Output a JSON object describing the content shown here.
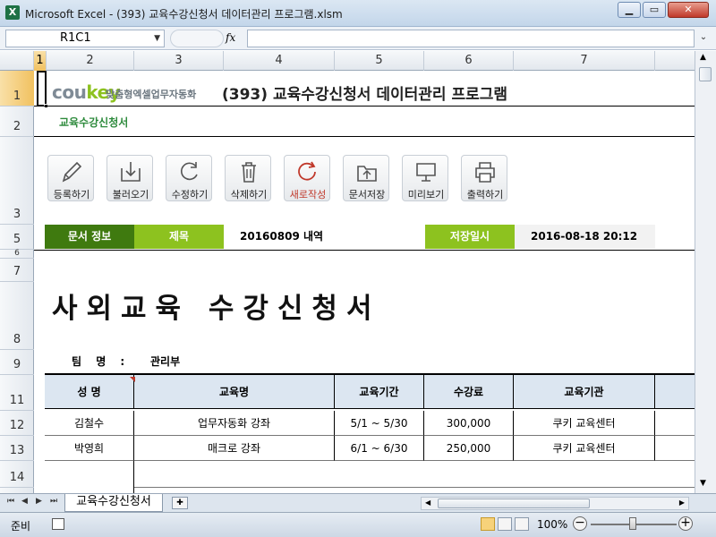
{
  "window": {
    "title": "Microsoft Excel - (393) 교육수강신청서 데이터관리 프로그램.xlsm",
    "app_icon": "X"
  },
  "formula_bar": {
    "name_box": "R1C1",
    "fx": "fx",
    "formula": ""
  },
  "columns": [
    "1",
    "2",
    "3",
    "4",
    "5",
    "6",
    "7"
  ],
  "rows": [
    "1",
    "2",
    "3",
    "5",
    "6",
    "7",
    "8",
    "9",
    "11",
    "12",
    "13",
    "14"
  ],
  "header": {
    "logo_main": "cou",
    "logo_key": "key",
    "logo_tag": "맞춤형엑셀업무자동화",
    "title": "(393) 교육수강신청서 데이터관리 프로그램"
  },
  "sheet_label": "교육수강신청서",
  "toolbar": [
    {
      "icon": "pencil-icon",
      "label": "등록하기"
    },
    {
      "icon": "download-icon",
      "label": "불러오기"
    },
    {
      "icon": "refresh-icon",
      "label": "수정하기"
    },
    {
      "icon": "trash-icon",
      "label": "삭제하기"
    },
    {
      "icon": "new-icon",
      "label": "새로작성"
    },
    {
      "icon": "folder-save-icon",
      "label": "문서저장"
    },
    {
      "icon": "monitor-icon",
      "label": "미리보기"
    },
    {
      "icon": "printer-icon",
      "label": "출력하기"
    }
  ],
  "info": {
    "doc_info_label": "문서 정보",
    "subject_label": "제목",
    "subject_value": "20160809 내역",
    "saved_label": "저장일시",
    "saved_value": "2016-08-18 20:12"
  },
  "document": {
    "title": "사외교육 수강신청서",
    "team_label": "팀 명 :",
    "team_value": "관리부"
  },
  "table": {
    "headers": [
      "성 명",
      "교육명",
      "교육기간",
      "수강료",
      "교육기관",
      ""
    ],
    "rows": [
      [
        "김철수",
        "업무자동화 강좌",
        "5/1 ~ 5/30",
        "300,000",
        "쿠키 교육센터",
        ""
      ],
      [
        "박영희",
        "매크로 강좌",
        "6/1 ~ 6/30",
        "250,000",
        "쿠키 교육센터",
        ""
      ],
      [
        "",
        "",
        "",
        "",
        "",
        ""
      ]
    ]
  },
  "tabs": {
    "sheet_tab": "교육수강신청서"
  },
  "status": {
    "ready": "준비",
    "zoom": "100%"
  },
  "colors": {
    "accent_dark_green": "#3f7a0f",
    "accent_green": "#8dc21f",
    "table_header": "#dce6f1"
  }
}
